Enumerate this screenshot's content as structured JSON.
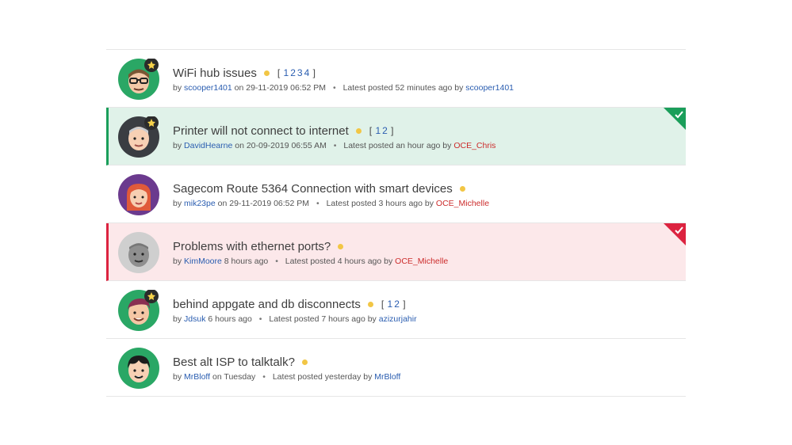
{
  "threads": [
    {
      "title": "WiFi hub issues",
      "pages": [
        "1",
        "2",
        "3",
        "4"
      ],
      "by": "by",
      "author": "scooper1401",
      "on_text": "on 29-11-2019 06:52 PM",
      "latest_text": "Latest posted 52 minutes ago by",
      "latest_user": "scooper1401"
    },
    {
      "title": "Printer will not connect to internet",
      "pages": [
        "1",
        "2"
      ],
      "by": "by",
      "author": "DavidHearne",
      "on_text": "on 20-09-2019 06:55 AM",
      "latest_text": "Latest posted an hour ago by",
      "latest_user": "OCE_Chris"
    },
    {
      "title": "Sagecom Route 5364 Connection with smart devices",
      "pages": [],
      "by": "by",
      "author": "mik23pe",
      "on_text": "on 29-11-2019 06:52 PM",
      "latest_text": "Latest posted  3 hours ago by",
      "latest_user": "OCE_Michelle"
    },
    {
      "title": "Problems with ethernet ports?",
      "pages": [],
      "by": "by",
      "author": "KimMoore",
      "on_text": "8 hours ago",
      "latest_text": "Latest posted 4 hours ago by",
      "latest_user": "OCE_Michelle"
    },
    {
      "title": "behind appgate and db disconnects",
      "pages": [
        "1",
        "2"
      ],
      "by": "by",
      "author": "Jdsuk",
      "on_text": "6 hours ago",
      "latest_text": "Latest posted 7 hours ago by",
      "latest_user": "azizurjahir"
    },
    {
      "title": "Best alt ISP to talktalk?",
      "pages": [],
      "by": "by",
      "author": "MrBloff",
      "on_text": "on Tuesday",
      "latest_text": "Latest posted yesterday by",
      "latest_user": "MrBloff"
    }
  ],
  "colors": {
    "accent_green": "#1a9e5a",
    "accent_red": "#dc2340",
    "link_blue": "#2a5db0",
    "staff_red": "#cc2c2c",
    "unread_dot": "#f2c645"
  },
  "icons": {
    "star_badge": "star-badge-icon",
    "check_corner": "check-corner-icon",
    "unread": "unread-dot-icon"
  }
}
